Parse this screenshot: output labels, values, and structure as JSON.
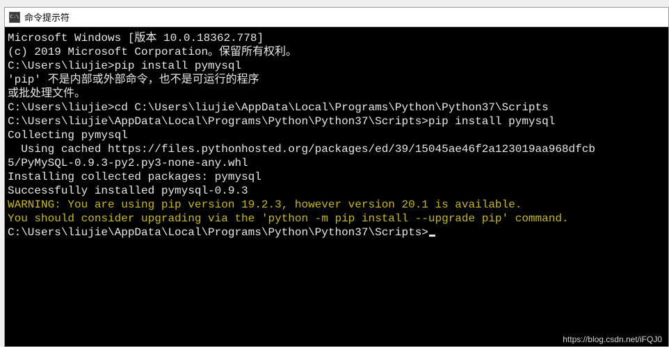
{
  "window": {
    "title": "命令提示符"
  },
  "terminal": {
    "lines": [
      {
        "text": "Microsoft Windows [版本 10.0.18362.778]",
        "color": "white"
      },
      {
        "text": "(c) 2019 Microsoft Corporation。保留所有权利。",
        "color": "white"
      },
      {
        "text": "",
        "color": "white"
      },
      {
        "text": "C:\\Users\\liujie>pip install pymysql",
        "color": "white"
      },
      {
        "text": "'pip' 不是内部或外部命令，也不是可运行的程序",
        "color": "white"
      },
      {
        "text": "或批处理文件。",
        "color": "white"
      },
      {
        "text": "",
        "color": "white"
      },
      {
        "text": "C:\\Users\\liujie>cd C:\\Users\\liujie\\AppData\\Local\\Programs\\Python\\Python37\\Scripts",
        "color": "white"
      },
      {
        "text": "",
        "color": "white"
      },
      {
        "text": "C:\\Users\\liujie\\AppData\\Local\\Programs\\Python\\Python37\\Scripts>pip install pymysql",
        "color": "white"
      },
      {
        "text": "Collecting pymysql",
        "color": "white"
      },
      {
        "text": "  Using cached https://files.pythonhosted.org/packages/ed/39/15045ae46f2a123019aa968dfcb",
        "color": "white"
      },
      {
        "text": "5/PyMySQL-0.9.3-py2.py3-none-any.whl",
        "color": "white"
      },
      {
        "text": "Installing collected packages: pymysql",
        "color": "white"
      },
      {
        "text": "Successfully installed pymysql-0.9.3",
        "color": "white"
      },
      {
        "text": "WARNING: You are using pip version 19.2.3, however version 20.1 is available.",
        "color": "yellow"
      },
      {
        "text": "You should consider upgrading via the 'python -m pip install --upgrade pip' command.",
        "color": "yellow"
      },
      {
        "text": "",
        "color": "white"
      }
    ],
    "last_prompt": "C:\\Users\\liujie\\AppData\\Local\\Programs\\Python\\Python37\\Scripts>"
  },
  "watermark": "https://blog.csdn.net/iFQJ0"
}
